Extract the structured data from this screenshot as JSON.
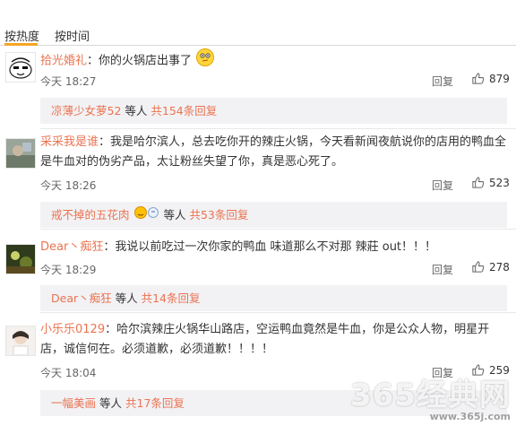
{
  "sort": {
    "hot": "按热度",
    "time": "按时间"
  },
  "comments": [
    {
      "user": "拾光婚礼",
      "colon": "：",
      "text": "你的火锅店出事了",
      "time": "今天 18:27",
      "reply": "回复",
      "likes": "879",
      "replies_box": {
        "who": "凉薄少女萝52",
        "and": "等人",
        "count": "共154条回复"
      }
    },
    {
      "user": "采采我是谁",
      "colon": "：",
      "text": "我是哈尔滨人，总去吃你开的辣庄火锅，今天看新闻夜航说你的店用的鸭血全是牛血对的伪劣产品，太让粉丝失望了你，真是恶心死了。",
      "time": "今天 18:26",
      "reply": "回复",
      "likes": "523",
      "replies_box": {
        "who": "戒不掉的五花肉",
        "and": "等人",
        "count": "共53条回复"
      }
    },
    {
      "user": "Dear丶痴狂",
      "colon": "：",
      "text": "我说以前吃过一次你家的鸭血 味道那么不对那  辣莊 out！！！",
      "time": "今天 18:29",
      "reply": "回复",
      "likes": "278",
      "replies_box": {
        "who": "Dear丶痴狂",
        "and": "等人",
        "count": "共14条回复"
      }
    },
    {
      "user": "小乐乐0129",
      "colon": "：",
      "text": "哈尔滨辣庄火锅华山路店，空运鸭血竟然是牛血，你是公众人物，明星开店，诚信何在。必须道歉，必须道歉！！！！",
      "time": "今天 18:04",
      "reply": "回复",
      "likes": "259",
      "replies_box": {
        "who": "一幅美画",
        "and": "等人",
        "count": "共17条回复"
      }
    }
  ],
  "watermark": {
    "main": "365经典网",
    "sub": "www.365j.com"
  },
  "colors": {
    "username": "#eb7350",
    "accent": "#f5a623",
    "reply_bg": "#f2f2f5"
  }
}
